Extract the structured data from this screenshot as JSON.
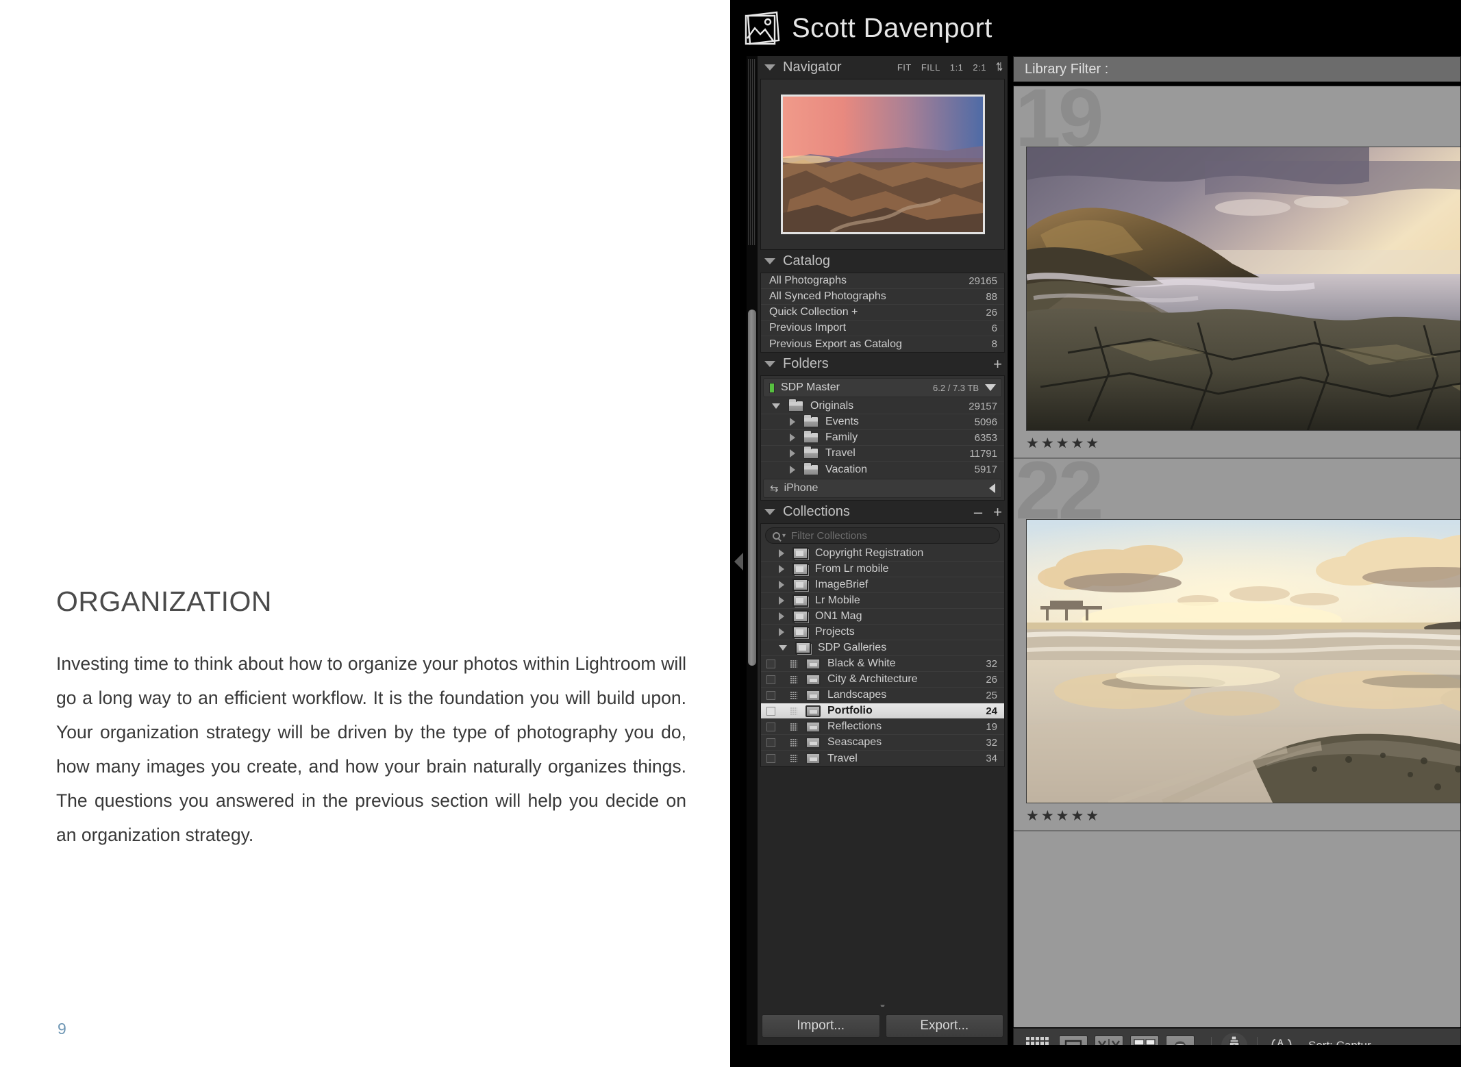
{
  "book": {
    "title": "ORGANIZATION",
    "paragraph": "Investing time to think about how to organize your photos within Lightroom will go a long way to an efficient workflow. It is the foundation you will build upon. Your organization strategy will be driven by the type of photography you do, how many images you create, and how your brain naturally organizes things. The questions you answered in the previous section will help you decide on an organization strategy.",
    "page_number": "9",
    "page_number_color": "#6e96b4"
  },
  "lightroom": {
    "identity_plate": {
      "name": "Scott Davenport",
      "logo_icon": "photos-stack-icon"
    },
    "navigator": {
      "title": "Navigator",
      "zoom_levels": [
        "FIT",
        "FILL",
        "1:1",
        "2:1"
      ],
      "stepper_icon": "up-down-arrows-icon",
      "preview_alt": "desert badlands at sunset"
    },
    "catalog": {
      "title": "Catalog",
      "rows": [
        {
          "label": "All Photographs",
          "count": "29165"
        },
        {
          "label": "All Synced Photographs",
          "count": "88"
        },
        {
          "label": "Quick Collection  +",
          "count": "26"
        },
        {
          "label": "Previous Import",
          "count": "6"
        },
        {
          "label": "Previous Export as Catalog",
          "count": "8"
        }
      ]
    },
    "folders": {
      "title": "Folders",
      "add_icon": "plus-icon",
      "volume": {
        "name": "SDP Master",
        "size": "6.2 / 7.3 TB",
        "status_color": "#57c040"
      },
      "tree": [
        {
          "label": "Originals",
          "count": "29157",
          "depth": 0,
          "expanded": true
        },
        {
          "label": "Events",
          "count": "5096",
          "depth": 1,
          "expanded": false
        },
        {
          "label": "Family",
          "count": "6353",
          "depth": 1,
          "expanded": false
        },
        {
          "label": "Travel",
          "count": "11791",
          "depth": 1,
          "expanded": false
        },
        {
          "label": "Vacation",
          "count": "5917",
          "depth": 1,
          "expanded": false
        }
      ],
      "device": {
        "name": "iPhone",
        "sync_icon": "sync-arrows-icon"
      }
    },
    "collections": {
      "title": "Collections",
      "remove_icon": "minus-icon",
      "add_icon": "plus-icon",
      "filter_placeholder": "Filter Collections",
      "search_icon": "search-icon",
      "items": [
        {
          "label": "Copyright Registration",
          "count": "",
          "type": "set",
          "depth": 0,
          "expanded": false,
          "selected": false
        },
        {
          "label": "From Lr mobile",
          "count": "",
          "type": "set",
          "depth": 0,
          "expanded": false,
          "selected": false
        },
        {
          "label": "ImageBrief",
          "count": "",
          "type": "set",
          "depth": 0,
          "expanded": false,
          "selected": false
        },
        {
          "label": "Lr Mobile",
          "count": "",
          "type": "set",
          "depth": 0,
          "expanded": false,
          "selected": false
        },
        {
          "label": "ON1 Mag",
          "count": "",
          "type": "set",
          "depth": 0,
          "expanded": false,
          "selected": false
        },
        {
          "label": "Projects",
          "count": "",
          "type": "set",
          "depth": 0,
          "expanded": false,
          "selected": false
        },
        {
          "label": "SDP Galleries",
          "count": "",
          "type": "set",
          "depth": 0,
          "expanded": true,
          "selected": false
        },
        {
          "label": "Black & White",
          "count": "32",
          "type": "collection",
          "depth": 1,
          "expanded": false,
          "selected": false
        },
        {
          "label": "City & Architecture",
          "count": "26",
          "type": "collection",
          "depth": 1,
          "expanded": false,
          "selected": false
        },
        {
          "label": "Landscapes",
          "count": "25",
          "type": "collection",
          "depth": 1,
          "expanded": false,
          "selected": false
        },
        {
          "label": "Portfolio",
          "count": "24",
          "type": "collection",
          "depth": 1,
          "expanded": false,
          "selected": true
        },
        {
          "label": "Reflections",
          "count": "19",
          "type": "collection",
          "depth": 1,
          "expanded": false,
          "selected": false
        },
        {
          "label": "Seascapes",
          "count": "32",
          "type": "collection",
          "depth": 1,
          "expanded": false,
          "selected": false
        },
        {
          "label": "Travel",
          "count": "34",
          "type": "collection",
          "depth": 1,
          "expanded": false,
          "selected": false
        }
      ]
    },
    "footer": {
      "import_label": "Import...",
      "export_label": "Export..."
    },
    "library_filter": {
      "label": "Library Filter :"
    },
    "grid": {
      "cells": [
        {
          "index": "19",
          "rating": "★★★★★",
          "badge_icon": "crop-badge-icon",
          "alt": "sea cliff sunset over tide-pool rocks"
        },
        {
          "index": "22",
          "rating": "★★★★★",
          "badge_icon": "crop-badge-icon",
          "alt": "beach reflections at sunset with rock"
        }
      ]
    },
    "toolbar": {
      "view_icons": [
        {
          "name": "grid-view-icon"
        },
        {
          "name": "loupe-view-icon"
        },
        {
          "name": "compare-view-icon"
        },
        {
          "name": "survey-view-icon"
        },
        {
          "name": "people-view-icon"
        }
      ],
      "paint_icon": "spray-can-icon",
      "sort_icon": "sort-az-icon",
      "sort_label": "Sort:  Captur"
    }
  }
}
